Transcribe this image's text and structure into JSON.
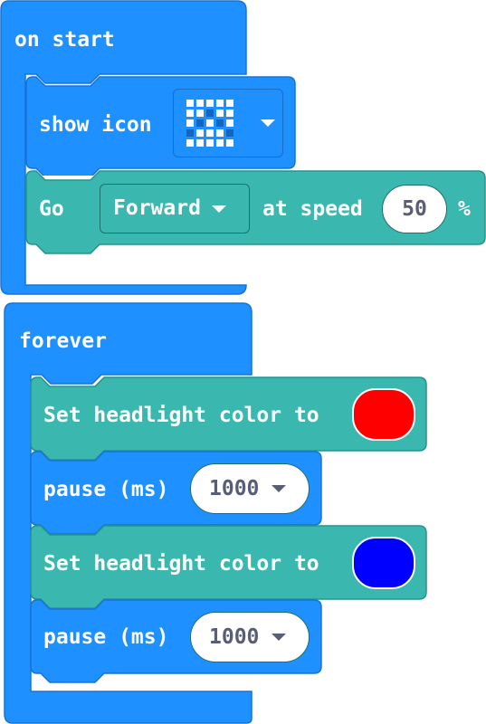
{
  "colors": {
    "block_blue": "#1e90ff",
    "block_blue_border": "#1a73cf",
    "block_teal": "#3ab8b0",
    "block_teal_border": "#27928c",
    "swatch_red": "#ff0000",
    "swatch_blue": "#0000ff"
  },
  "on_start": {
    "label": "on start",
    "show_icon": {
      "label": "show icon",
      "icon_name": "small-diamond-led-icon",
      "leds": [
        [
          1,
          1,
          1,
          1,
          1
        ],
        [
          1,
          1,
          0,
          1,
          1
        ],
        [
          1,
          0,
          1,
          0,
          1
        ],
        [
          0,
          1,
          1,
          1,
          0
        ],
        [
          1,
          1,
          1,
          1,
          1
        ]
      ]
    },
    "go": {
      "label": "Go",
      "direction": "Forward",
      "at_speed_label": "at speed",
      "speed_value": "50",
      "percent_label": "%"
    }
  },
  "forever": {
    "label": "forever",
    "statements": [
      {
        "type": "set_headlight",
        "label": "Set headlight color to",
        "color": "red"
      },
      {
        "type": "pause",
        "label": "pause (ms)",
        "value": "1000"
      },
      {
        "type": "set_headlight",
        "label": "Set headlight color to",
        "color": "blue"
      },
      {
        "type": "pause",
        "label": "pause (ms)",
        "value": "1000"
      }
    ]
  }
}
